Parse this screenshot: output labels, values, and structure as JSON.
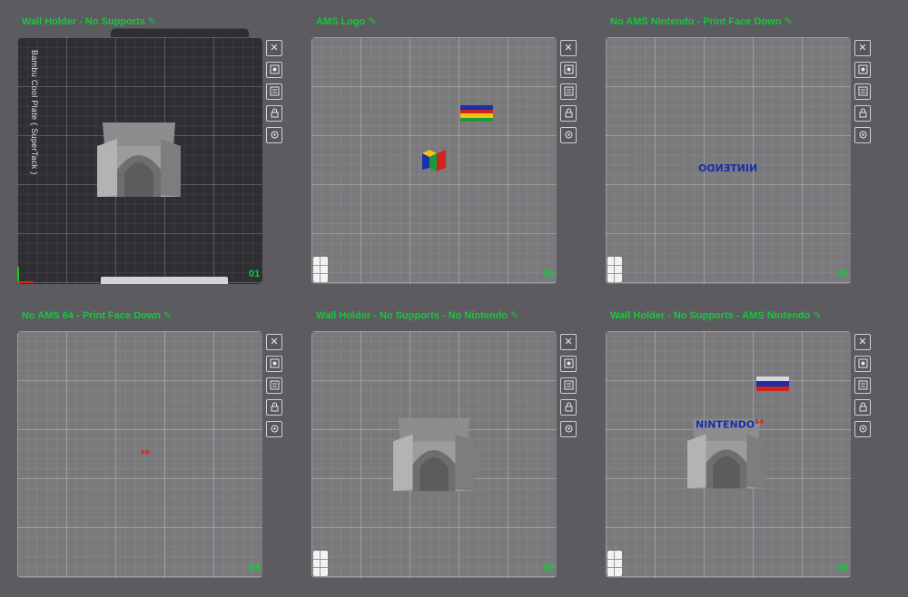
{
  "plates": [
    {
      "name": "Wall Holder - No Supports",
      "number": "01",
      "plate_label": "Bambu Cool Plate ( SuperTack )"
    },
    {
      "name": "AMS Logo",
      "number": "02"
    },
    {
      "name": "No AMS Nintendo - Print Face Down",
      "number": "03",
      "mirrored_text": "NINTENDO"
    },
    {
      "name": "No AMS 64 - Print Face Down",
      "number": "04",
      "small_text": "64"
    },
    {
      "name": "Wall Holder - No Supports - No Nintendo",
      "number": "05"
    },
    {
      "name": "Wall Holder - No Supports - AMS Nintendo",
      "number": "06",
      "logo_text": "NINTENDO",
      "logo_sup": "64"
    }
  ],
  "toolbar_icons": [
    "close-icon",
    "arrange-icon",
    "layers-icon",
    "lock-icon",
    "settings-icon"
  ],
  "edit_glyph": "✎",
  "colors": {
    "title_green": "#15c93a",
    "background": "#5b5b60",
    "plate_gray": "#7a7a7d",
    "plate_dark": "#2f2f33",
    "model_gray": "#9a9a9c",
    "nintendo_blue": "#1a2fa8",
    "n64_red": "#d2231e"
  }
}
